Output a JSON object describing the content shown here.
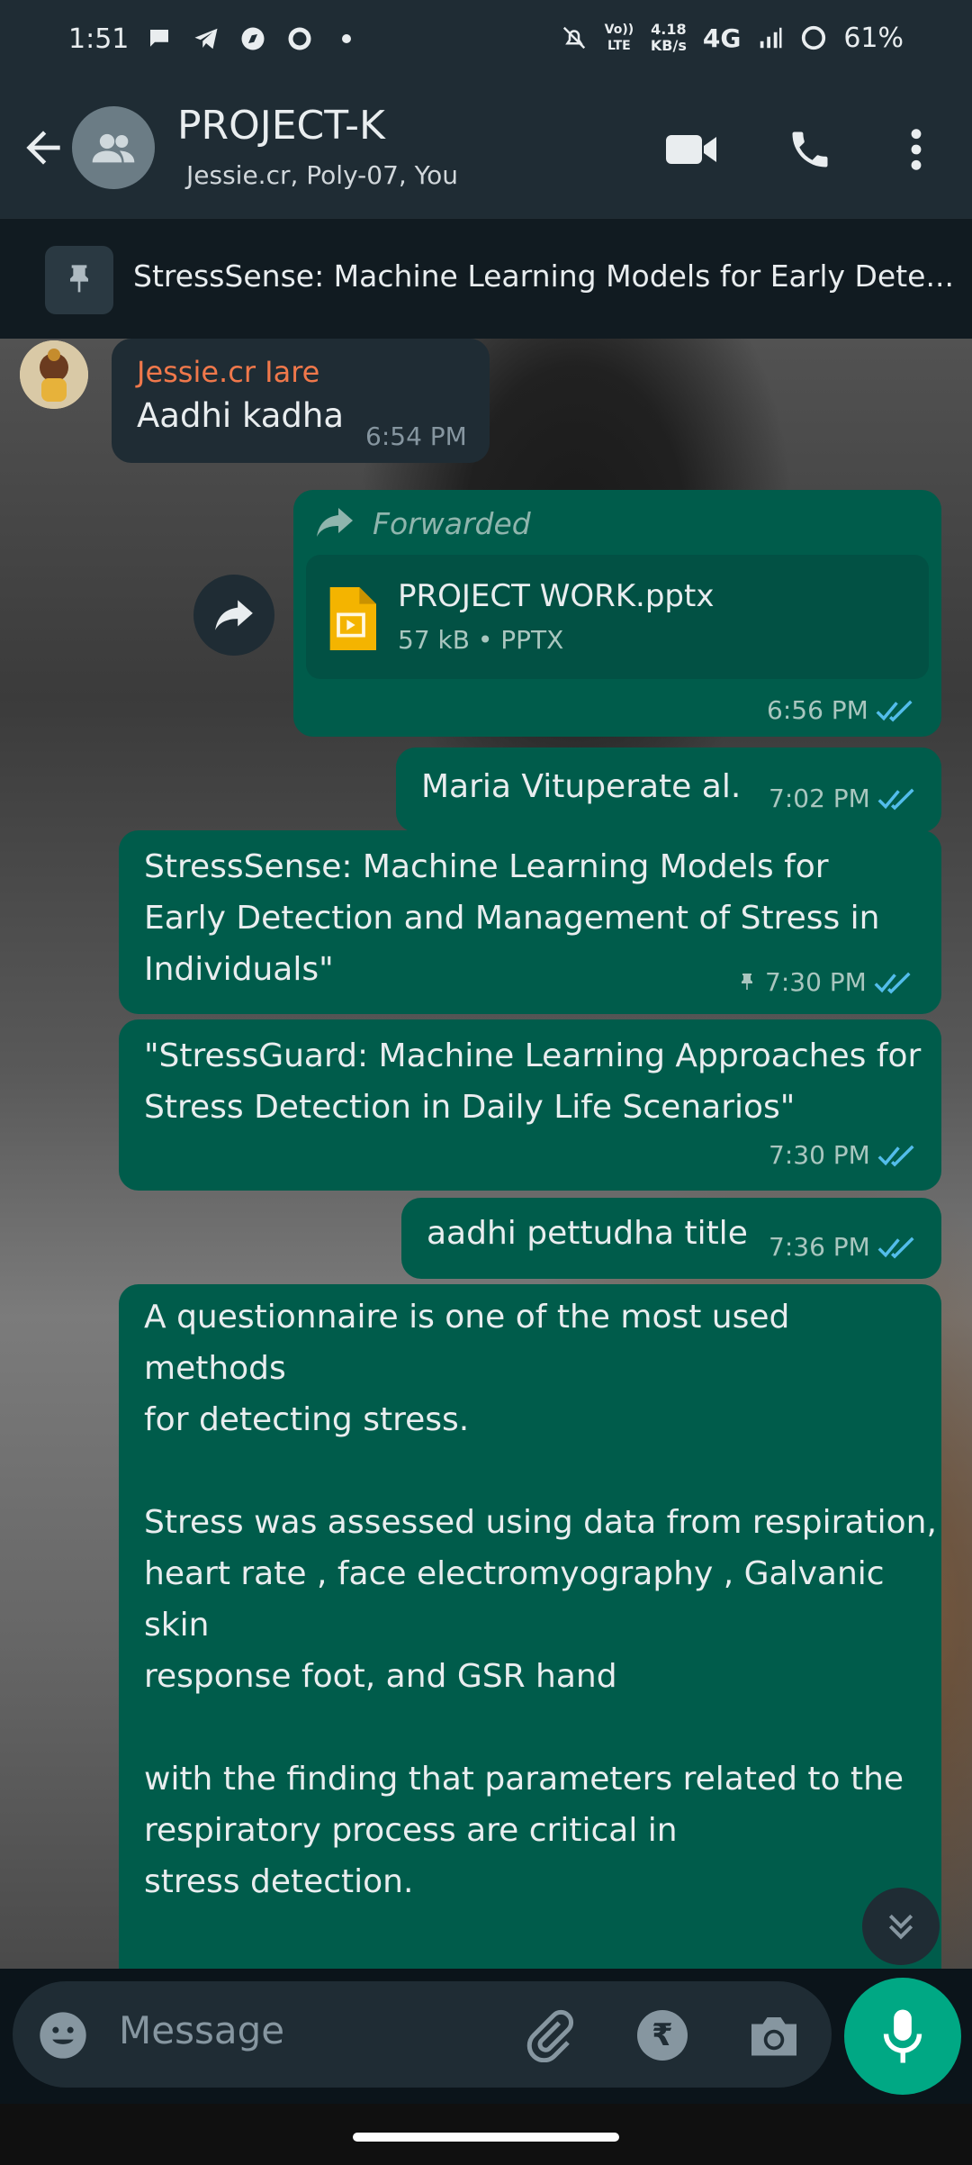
{
  "status_bar": {
    "time": "1:51",
    "speed_top": "4.18",
    "speed_bottom": "KB/s",
    "volte": "Vo)) LTE",
    "network": "4G",
    "battery": "61%"
  },
  "header": {
    "group_name": "PROJECT-K",
    "members": "Jessie.cr, Poly-07, You"
  },
  "pinned": {
    "text": "StressSense: Machine Learning Models for Early Dete..."
  },
  "messages": [
    {
      "sender": "Jessie.cr Iare",
      "text": "Aadhi kadha",
      "time": "6:54 PM"
    },
    {
      "forwarded_label": "Forwarded",
      "file_name": "PROJECT WORK.pptx",
      "file_info": "57 kB • PPTX",
      "time": "6:56 PM"
    },
    {
      "text": "Maria Vituperate al.",
      "time": "7:02 PM"
    },
    {
      "text": "StressSense: Machine Learning Models for\nEarly Detection and Management of Stress in\nIndividuals\"",
      "time": "7:30 PM"
    },
    {
      "text": "\"StressGuard: Machine Learning Approaches for\nStress Detection in Daily Life Scenarios\"",
      "time": "7:30 PM"
    },
    {
      "text": "aadhi pettudha title",
      "time": "7:36 PM"
    },
    {
      "text": "A questionnaire is one of the most used methods\nfor detecting stress.\n\nStress was assessed using data from respiration,\nheart rate , face electromyography , Galvanic\nskin\nresponse foot, and GSR hand\n\nwith the finding that parameters related to the\nrespiratory process are critical in\nstress detection.\n\nghaderi tal and maria vituperate ai"
    }
  ],
  "input": {
    "placeholder": "Message",
    "rupee_symbol": "₹"
  },
  "colors": {
    "header_bg": "#1f2c34",
    "outgoing_bubble": "#005c4b",
    "incoming_bubble": "#1f2c34",
    "sender_name": "#f0784b",
    "tick_read": "#53bdeb",
    "accent": "#00a884"
  }
}
